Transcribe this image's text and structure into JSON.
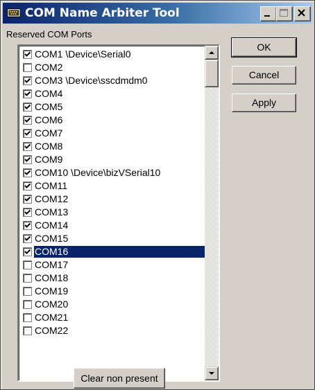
{
  "window": {
    "title": "COM Name Arbiter Tool",
    "icons": {
      "app": "serial-port-icon",
      "minimize": "minimize-icon",
      "maximize": "maximize-icon",
      "close": "close-icon"
    }
  },
  "list": {
    "label": "Reserved COM Ports",
    "items": [
      {
        "text": "COM1  \\Device\\Serial0",
        "checked": true,
        "selected": false
      },
      {
        "text": "COM2",
        "checked": false,
        "selected": false
      },
      {
        "text": "COM3  \\Device\\sscdmdm0",
        "checked": true,
        "selected": false
      },
      {
        "text": "COM4",
        "checked": true,
        "selected": false
      },
      {
        "text": "COM5",
        "checked": true,
        "selected": false
      },
      {
        "text": "COM6",
        "checked": true,
        "selected": false
      },
      {
        "text": "COM7",
        "checked": true,
        "selected": false
      },
      {
        "text": "COM8",
        "checked": true,
        "selected": false
      },
      {
        "text": "COM9",
        "checked": true,
        "selected": false
      },
      {
        "text": "COM10  \\Device\\bizVSerial10",
        "checked": true,
        "selected": false
      },
      {
        "text": "COM11",
        "checked": true,
        "selected": false
      },
      {
        "text": "COM12",
        "checked": true,
        "selected": false
      },
      {
        "text": "COM13",
        "checked": true,
        "selected": false
      },
      {
        "text": "COM14",
        "checked": true,
        "selected": false
      },
      {
        "text": "COM15",
        "checked": true,
        "selected": false
      },
      {
        "text": "COM16",
        "checked": true,
        "selected": true
      },
      {
        "text": "COM17",
        "checked": false,
        "selected": false
      },
      {
        "text": "COM18",
        "checked": false,
        "selected": false
      },
      {
        "text": "COM19",
        "checked": false,
        "selected": false
      },
      {
        "text": "COM20",
        "checked": false,
        "selected": false
      },
      {
        "text": "COM21",
        "checked": false,
        "selected": false
      },
      {
        "text": "COM22",
        "checked": false,
        "selected": false
      }
    ],
    "scroll_position": 0
  },
  "buttons": {
    "ok": "OK",
    "cancel": "Cancel",
    "apply": "Apply",
    "clear_non_present": "Clear non present"
  },
  "colors": {
    "title_gradient_start": "#0a246a",
    "title_gradient_end": "#a6caf0",
    "selection": "#0a246a",
    "face": "#d4d0c8"
  }
}
